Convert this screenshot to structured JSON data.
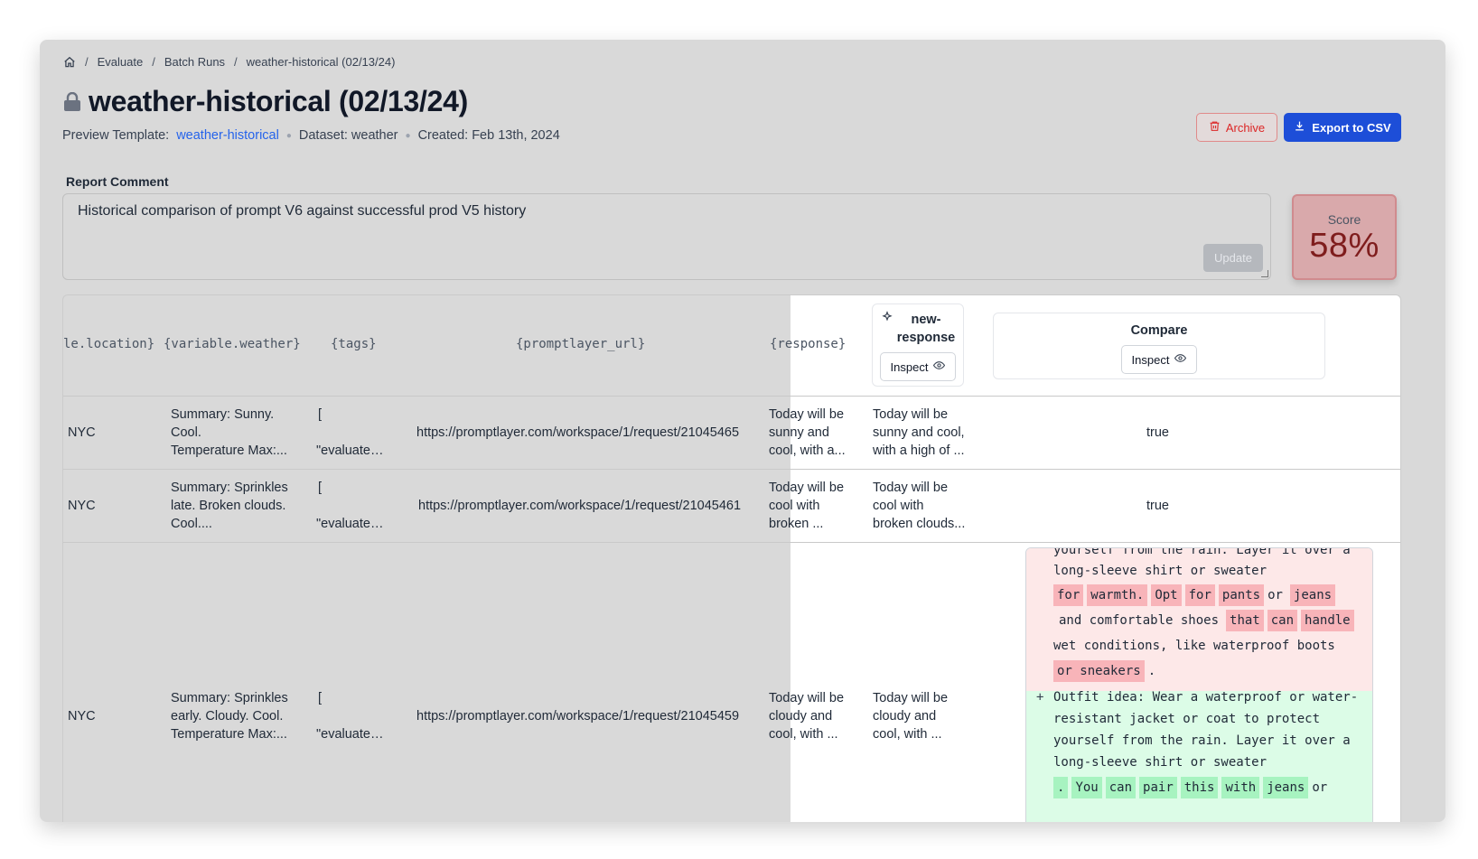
{
  "breadcrumb": {
    "items": [
      "Evaluate",
      "Batch Runs",
      "weather-historical (02/13/24)"
    ],
    "separator": "/"
  },
  "page": {
    "title": "weather-historical (02/13/24)",
    "template_label": "Preview Template:",
    "template_link": "weather-historical",
    "dataset": "Dataset: weather",
    "created": "Created: Feb 13th, 2024"
  },
  "actions": {
    "archive_label": "Archive",
    "export_label": "Export to CSV"
  },
  "comment": {
    "label": "Report Comment",
    "text": "Historical comparison of prompt V6 against successful prod V5 history",
    "update_label": "Update"
  },
  "score": {
    "label": "Score",
    "value": "58%"
  },
  "table": {
    "columns": {
      "location": "le.location}",
      "weather": "{variable.weather}",
      "tags": "{tags}",
      "url": "{promptlayer_url}",
      "response": "{response}",
      "new_response": "new-\nresponse",
      "compare": "Compare",
      "inspect": "Inspect"
    },
    "rows": [
      {
        "location": "NYC",
        "weather": [
          "Summary: Sunny.",
          "Cool.",
          "Temperature Max:..."
        ],
        "tags": [
          "[",
          "\"evaluate…"
        ],
        "url": "https://promptlayer.com/workspace/1/request/21045465",
        "response": [
          "Today will be",
          "sunny and",
          "cool, with a..."
        ],
        "new_response": [
          "Today will be",
          "sunny and cool,",
          "with a high of ..."
        ],
        "compare": "true"
      },
      {
        "location": "NYC",
        "weather": [
          "Summary: Sprinkles",
          "late. Broken clouds.",
          "Cool...."
        ],
        "tags": [
          "[",
          "\"evaluate…"
        ],
        "url": "https://promptlayer.com/workspace/1/request/21045461",
        "response": [
          "Today will be",
          "cool with",
          "broken ..."
        ],
        "new_response": [
          "Today will be",
          "cool with",
          "broken clouds..."
        ],
        "compare": "true"
      },
      {
        "location": "NYC",
        "weather": [
          "Summary: Sprinkles",
          "early. Cloudy. Cool.",
          "Temperature Max:..."
        ],
        "tags": [
          "[",
          "\"evaluate…"
        ],
        "url": "https://promptlayer.com/workspace/1/request/21045459",
        "response": [
          "Today will be",
          "cloudy and",
          "cool, with ..."
        ],
        "new_response": [
          "Today will be",
          "cloudy and",
          "cool, with ..."
        ]
      }
    ],
    "diff": {
      "removed_lines": [
        "yourself from the rain. Layer it over a",
        "long-sleeve shirt or sweater"
      ],
      "removed_tokens_line3": [
        "for",
        "warmth.",
        "Opt",
        "for",
        "pants"
      ],
      "removed_plain_line3": "or",
      "removed_tokens_line3b": [
        "jeans"
      ],
      "removed_line4_plain": "and comfortable shoes",
      "removed_tokens_line4": [
        "that",
        "can",
        "handle"
      ],
      "removed_line5": "wet conditions, like waterproof boots",
      "removed_tokens_line6": [
        "or sneakers"
      ],
      "removed_line6_tail": ".",
      "added_marker": "+",
      "added_lines": [
        "Outfit idea: Wear a waterproof or water-",
        "resistant jacket or coat to protect",
        "yourself from the rain. Layer it over a",
        "long-sleeve shirt or sweater"
      ],
      "added_tokens_last": [
        ".",
        "You",
        "can",
        "pair",
        "this",
        "with",
        "jeans"
      ],
      "added_last_tail": "or"
    }
  },
  "colors": {
    "accent_blue": "#1d4ed8",
    "link_blue": "#2563eb",
    "danger_red": "#dc2626",
    "score_red": "#7f1d1d",
    "diff_removed": "#fde8e8",
    "diff_added": "#dcfce7"
  },
  "icons": [
    "home-icon",
    "lock-icon",
    "trash-icon",
    "download-icon",
    "sparkles-icon",
    "eye-icon"
  ]
}
